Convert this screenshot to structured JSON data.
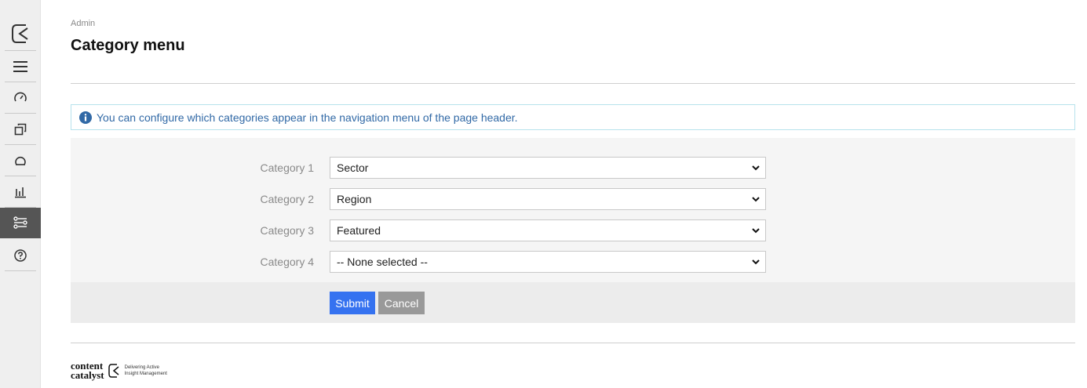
{
  "sidebar": {
    "items": [
      {
        "name": "logo",
        "icon": "content-catalyst-logo-icon"
      },
      {
        "name": "menu",
        "icon": "hamburger-menu-icon"
      },
      {
        "name": "dashboard",
        "icon": "speedometer-icon"
      },
      {
        "name": "content",
        "icon": "copy-icon"
      },
      {
        "name": "search",
        "icon": "magnifier-icon"
      },
      {
        "name": "analytics",
        "icon": "bar-chart-icon"
      },
      {
        "name": "admin",
        "icon": "sliders-icon",
        "active": true
      },
      {
        "name": "help",
        "icon": "question-circle-icon"
      }
    ]
  },
  "header": {
    "breadcrumb": "Admin",
    "title": "Category menu"
  },
  "info": {
    "text": "You can configure which categories appear in the navigation menu of the page header."
  },
  "form": {
    "rows": [
      {
        "label": "Category 1",
        "value": "Sector"
      },
      {
        "label": "Category 2",
        "value": "Region"
      },
      {
        "label": "Category 3",
        "value": "Featured"
      },
      {
        "label": "Category 4",
        "value": "-- None selected --"
      }
    ],
    "submit_label": "Submit",
    "cancel_label": "Cancel"
  },
  "footer": {
    "brand_line1": "content",
    "brand_line2": "catalyst",
    "tagline_line1": "Delivering Active",
    "tagline_line2": "Insight Management"
  },
  "colors": {
    "primary": "#3572f0",
    "info_text": "#3169a6",
    "sidebar_active": "#555555"
  }
}
